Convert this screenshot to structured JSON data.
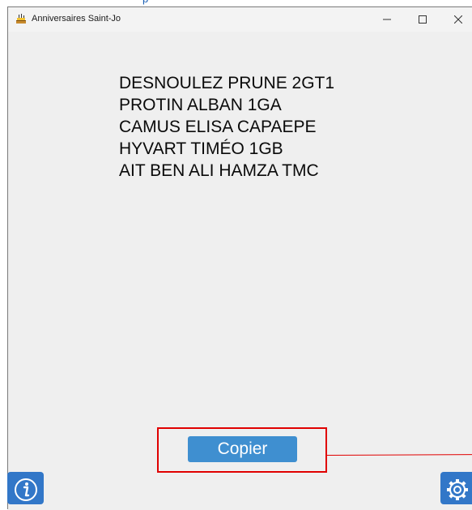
{
  "window": {
    "title": "Anniversaires Saint-Jo"
  },
  "top_strip": {
    "text": "p"
  },
  "window_controls": {
    "minimize_icon": "minimize-icon",
    "maximize_icon": "maximize-icon",
    "close_icon": "close-icon"
  },
  "names": [
    "DESNOULEZ PRUNE 2GT1",
    "PROTIN ALBAN 1GA",
    "CAMUS ELISA CAPAEPE",
    "HYVART TIMÉO 1GB",
    "AIT BEN ALI HAMZA TMC"
  ],
  "buttons": {
    "copy_label": "Copier",
    "info_icon": "info-icon",
    "settings_icon": "gear-icon"
  },
  "colors": {
    "accent": "#3f8fd0",
    "icon_button": "#3277c8",
    "annotation": "#e00000",
    "window_background": "#efefef"
  }
}
